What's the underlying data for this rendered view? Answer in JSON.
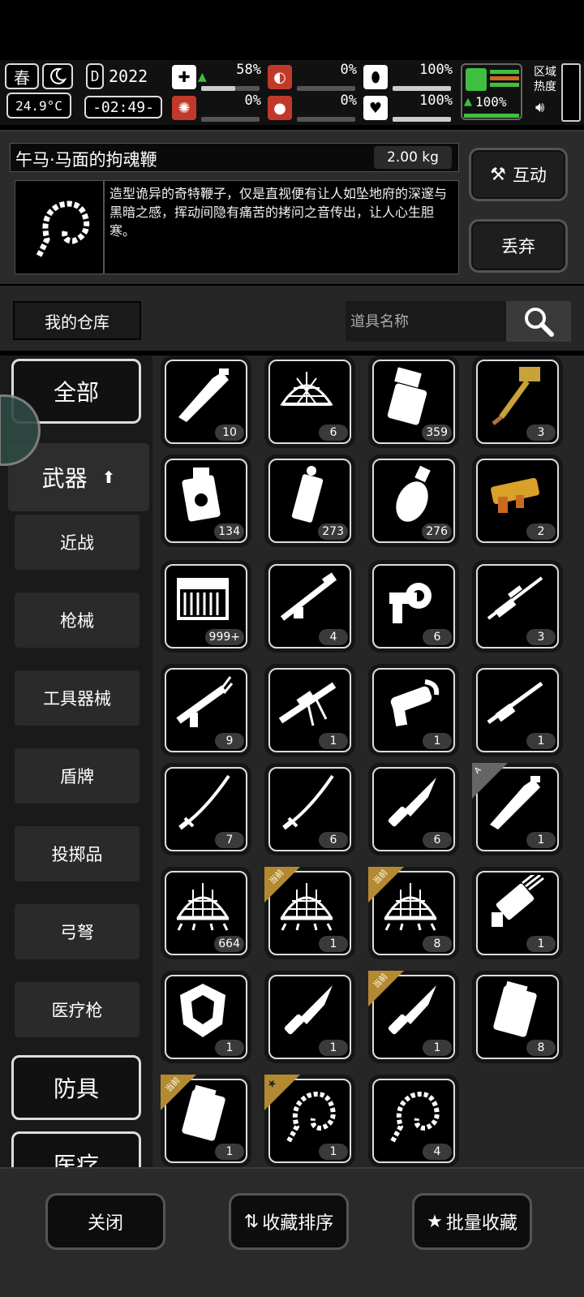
{
  "hud": {
    "season": "春",
    "temperature": "24.9°C",
    "year": "2022",
    "time": "-02:49-",
    "health_pct": "58%",
    "hunger_pct": "0%",
    "armor_pct": "100%",
    "sanity_pct": "0%",
    "bleed_pct": "0%",
    "mood_pct": "100%",
    "stamina_pct": "100%",
    "area_heat_label": "区域\n热度"
  },
  "detail": {
    "name": "午马·马面的拘魂鞭",
    "weight": "2.00 kg",
    "description": "造型诡异的奇特鞭子，仅是直视便有让人如坠地府的深邃与黑暗之感，挥动间隐有痛苦的拷问之音传出，让人心生胆寒。",
    "interact_label": "互动",
    "discard_label": "丢弃"
  },
  "search": {
    "warehouse_label": "我的仓库",
    "placeholder": "道具名称"
  },
  "sidebar": {
    "all": "全部",
    "weapons": "武器",
    "subs": [
      "近战",
      "枪械",
      "工具器械",
      "盾牌",
      "投掷品",
      "弓弩",
      "医疗枪"
    ],
    "armor": "防具",
    "medical": "医疗"
  },
  "items": [
    {
      "icon": "machete-icon",
      "count": "10"
    },
    {
      "icon": "net-icon",
      "count": "6"
    },
    {
      "icon": "canister-icon",
      "count": "359"
    },
    {
      "icon": "golden-hammer-icon",
      "count": "3"
    },
    {
      "icon": "fire-grenade-icon",
      "count": "134"
    },
    {
      "icon": "smoke-grenade-icon",
      "count": "273"
    },
    {
      "icon": "frag-grenade-icon",
      "count": "276"
    },
    {
      "icon": "golden-blaster-icon",
      "count": "2"
    },
    {
      "icon": "ammo-crate-icon",
      "count": "999+"
    },
    {
      "icon": "rocket-launcher-icon",
      "count": "4"
    },
    {
      "icon": "flare-gun-icon",
      "count": "6"
    },
    {
      "icon": "sniper-rifle-icon",
      "count": "3"
    },
    {
      "icon": "assault-rifle-icon",
      "count": "9"
    },
    {
      "icon": "machine-gun-icon",
      "count": "1"
    },
    {
      "icon": "blaster-pistol-icon",
      "count": "1"
    },
    {
      "icon": "long-rifle-icon",
      "count": "1"
    },
    {
      "icon": "katana-icon",
      "count": "7"
    },
    {
      "icon": "katana-icon",
      "count": "6"
    },
    {
      "icon": "combat-knife-icon",
      "count": "6"
    },
    {
      "icon": "machete-icon",
      "count": "1",
      "tag": "A"
    },
    {
      "icon": "net-trap-icon",
      "count": "664"
    },
    {
      "icon": "net-trap-icon",
      "count": "1",
      "tag": "当前"
    },
    {
      "icon": "net-trap-icon",
      "count": "8",
      "tag": "当前"
    },
    {
      "icon": "minigun-icon",
      "count": "1"
    },
    {
      "icon": "shield-icon",
      "count": "1"
    },
    {
      "icon": "combat-knife-icon",
      "count": "1"
    },
    {
      "icon": "combat-knife-icon",
      "count": "1",
      "tag": "当前"
    },
    {
      "icon": "cargo-pack-icon",
      "count": "8"
    },
    {
      "icon": "cargo-pack-icon",
      "count": "1",
      "tag": "当前"
    },
    {
      "icon": "bone-whip-icon",
      "count": "1",
      "tag": "star"
    },
    {
      "icon": "bone-whip-icon",
      "count": "4"
    }
  ],
  "bottom": {
    "close": "关闭",
    "sort": "收藏排序",
    "batch": "批量收藏"
  },
  "colors": {
    "gold": "#b48a30",
    "panel": "#262626",
    "green": "#3fbf3f",
    "red": "#c0392b"
  }
}
